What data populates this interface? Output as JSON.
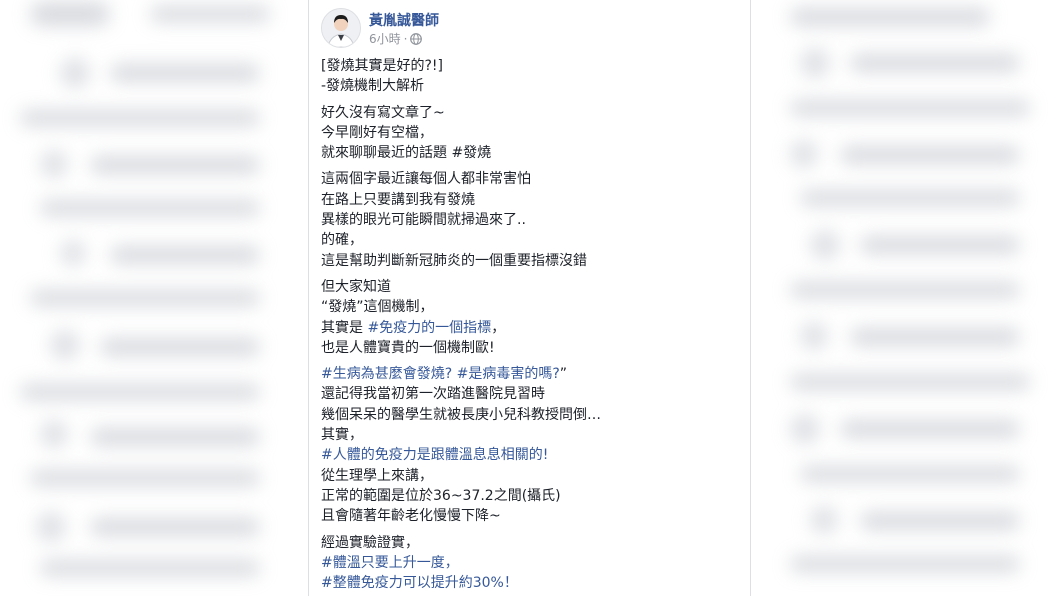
{
  "post": {
    "author": "黃胤誠醫師",
    "time": "6小時",
    "separator": "·",
    "privacy_icon": "globe-icon",
    "paragraphs": [
      [
        [
          {
            "t": "[發燒其實是好的?!]"
          }
        ],
        [
          {
            "t": "-發燒機制大解析"
          }
        ]
      ],
      [
        [
          {
            "t": "好久沒有寫文章了~"
          }
        ],
        [
          {
            "t": "今早剛好有空檔，"
          }
        ],
        [
          {
            "t": "就來聊聊最近的話題 #發燒"
          }
        ]
      ],
      [
        [
          {
            "t": "這兩個字最近讓每個人都非常害怕"
          }
        ],
        [
          {
            "t": "在路上只要講到我有發燒"
          }
        ],
        [
          {
            "t": "異樣的眼光可能瞬間就掃過來了.."
          }
        ],
        [
          {
            "t": "的確，"
          }
        ],
        [
          {
            "t": "這是幫助判斷新冠肺炎的一個重要指標沒錯"
          }
        ]
      ],
      [
        [
          {
            "t": "但大家知道"
          }
        ],
        [
          {
            "t": "“發燒”這個機制，"
          }
        ],
        [
          {
            "t": "其實是 "
          },
          {
            "t": "#免疫力的一個指標",
            "link": true
          },
          {
            "t": "，"
          }
        ],
        [
          {
            "t": "也是人體寶貴的一個機制歐!"
          }
        ]
      ],
      [
        [
          {
            "t": "#生病為甚麼會發燒? #是病毒害的嗎?",
            "link": true
          },
          {
            "t": "”"
          }
        ],
        [
          {
            "t": "還記得我當初第一次踏進醫院見習時"
          }
        ],
        [
          {
            "t": "幾個呆呆的醫學生就被長庚小兒科教授問倒…"
          }
        ],
        [
          {
            "t": "其實，"
          }
        ],
        [
          {
            "t": "#人體的免疫力是跟體溫息息相關的!",
            "link": true
          }
        ],
        [
          {
            "t": "從生理學上來講，"
          }
        ],
        [
          {
            "t": "正常的範圍是位於36~37.2之間(攝氏)"
          }
        ],
        [
          {
            "t": "且會隨著年齡老化慢慢下降~"
          }
        ]
      ],
      [
        [
          {
            "t": "經過實驗證實，"
          }
        ],
        [
          {
            "t": "#體溫只要上升一度，",
            "link": true
          }
        ],
        [
          {
            "t": "#整體免疫力可以提升約30%！",
            "link": true
          }
        ]
      ]
    ]
  },
  "colors": {
    "link": "#365899",
    "text": "#1d2129",
    "meta": "#90949c",
    "page_bg": "#ffffff"
  }
}
